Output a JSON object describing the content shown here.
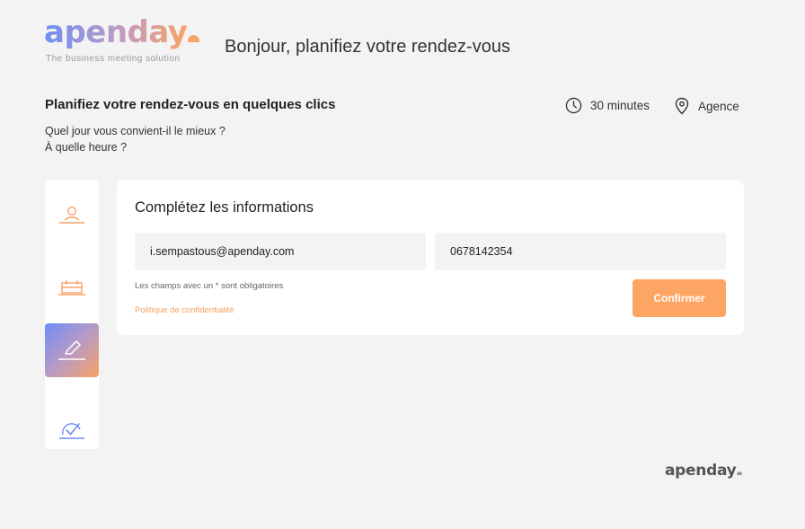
{
  "header": {
    "logo_text": "apenday",
    "tagline": "The business meeting solution",
    "title": "Bonjour, planifiez votre rendez-vous"
  },
  "intro": {
    "heading": "Planifiez votre rendez-vous en quelques clics",
    "question_day": "Quel jour vous convient-il le mieux ?",
    "question_time": "À quelle heure ?"
  },
  "meta": {
    "duration": "30 minutes",
    "location": "Agence",
    "duration_icon": "clock-icon",
    "location_icon": "map-pin-icon"
  },
  "steps": [
    {
      "name": "user-step",
      "icon": "user-icon",
      "active": false
    },
    {
      "name": "calendar-step",
      "icon": "calendar-icon",
      "active": false
    },
    {
      "name": "form-step",
      "icon": "pencil-icon",
      "active": true
    },
    {
      "name": "confirm-step",
      "icon": "check-icon",
      "active": false
    }
  ],
  "form": {
    "title": "Complétez les informations",
    "email_value": "i.sempastous@apenday.com",
    "phone_value": "0678142354",
    "required_note": "Les champs avec un * sont obligatoires",
    "privacy_link": "Politique de confidentialité",
    "confirm_label": "Confirmer"
  },
  "footer": {
    "logo_text": "apenday"
  },
  "colors": {
    "accent_orange": "#fda562",
    "accent_blue": "#6e8ef5",
    "background": "#f3f3f3",
    "card": "#ffffff"
  }
}
